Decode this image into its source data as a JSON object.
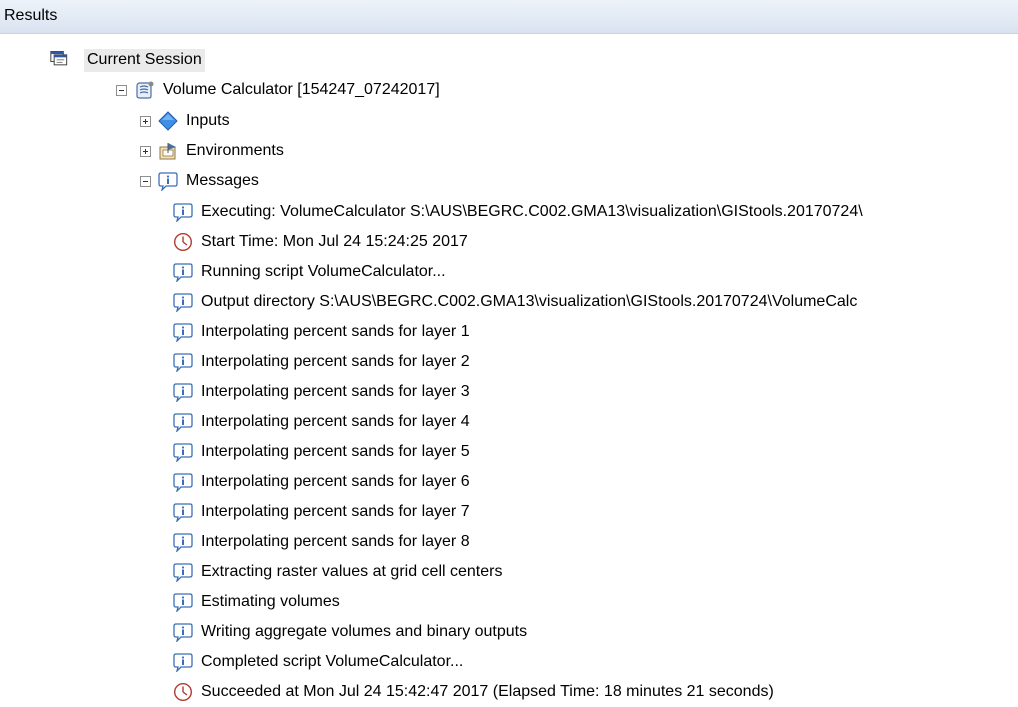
{
  "panel": {
    "title": "Results"
  },
  "tree": {
    "session_label": "Current Session",
    "tool_label": "Volume Calculator [154247_07242017]",
    "inputs_label": "Inputs",
    "environments_label": "Environments",
    "messages_label": "Messages"
  },
  "messages": [
    {
      "icon": "info-icon",
      "text": "Executing: VolumeCalculator S:\\AUS\\BEGRC.C002.GMA13\\visualization\\GIStools.20170724\\"
    },
    {
      "icon": "clock-icon",
      "text": "Start Time: Mon Jul 24 15:24:25 2017"
    },
    {
      "icon": "info-icon",
      "text": "Running script VolumeCalculator..."
    },
    {
      "icon": "info-icon",
      "text": "Output directory S:\\AUS\\BEGRC.C002.GMA13\\visualization\\GIStools.20170724\\VolumeCalc"
    },
    {
      "icon": "info-icon",
      "text": "Interpolating percent sands for layer 1"
    },
    {
      "icon": "info-icon",
      "text": "Interpolating percent sands for layer 2"
    },
    {
      "icon": "info-icon",
      "text": "Interpolating percent sands for layer 3"
    },
    {
      "icon": "info-icon",
      "text": "Interpolating percent sands for layer 4"
    },
    {
      "icon": "info-icon",
      "text": "Interpolating percent sands for layer 5"
    },
    {
      "icon": "info-icon",
      "text": "Interpolating percent sands for layer 6"
    },
    {
      "icon": "info-icon",
      "text": "Interpolating percent sands for layer 7"
    },
    {
      "icon": "info-icon",
      "text": "Interpolating percent sands for layer 8"
    },
    {
      "icon": "info-icon",
      "text": "Extracting raster values at grid cell centers"
    },
    {
      "icon": "info-icon",
      "text": "Estimating volumes"
    },
    {
      "icon": "info-icon",
      "text": "Writing aggregate volumes and binary outputs"
    },
    {
      "icon": "info-icon",
      "text": "Completed script VolumeCalculator..."
    },
    {
      "icon": "clock-icon",
      "text": "Succeeded at Mon Jul 24 15:42:47 2017 (Elapsed Time: 18 minutes 21 seconds)"
    }
  ]
}
